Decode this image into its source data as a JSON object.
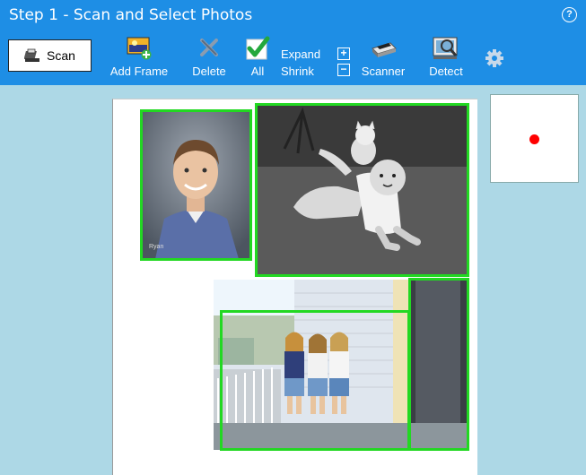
{
  "header": {
    "title": "Step 1 - Scan and Select Photos",
    "help_symbol": "?"
  },
  "toolbar": {
    "scan_label": "Scan",
    "add_frame_label": "Add Frame",
    "delete_label": "Delete",
    "all_label": "All",
    "expand_label": "Expand",
    "shrink_label": "Shrink",
    "plus_symbol": "+",
    "minus_symbol": "−",
    "scanner_label": "Scanner",
    "detect_label": "Detect"
  },
  "scan_area": {
    "photos": [
      {
        "name": "school-portrait",
        "caption": "Ryan"
      },
      {
        "name": "baby-with-cat"
      },
      {
        "name": "girls-on-porch"
      }
    ]
  },
  "colors": {
    "header_bg": "#1e8ee5",
    "content_bg": "#add8e6",
    "frame": "#22d822",
    "preview_dot": "#ff0000"
  },
  "icons": [
    "scanner-icon",
    "add-frame-icon",
    "delete-icon",
    "select-all-icon",
    "expand-icon",
    "shrink-icon",
    "scanner-settings-icon",
    "detect-icon",
    "gear-icon",
    "help-icon"
  ]
}
